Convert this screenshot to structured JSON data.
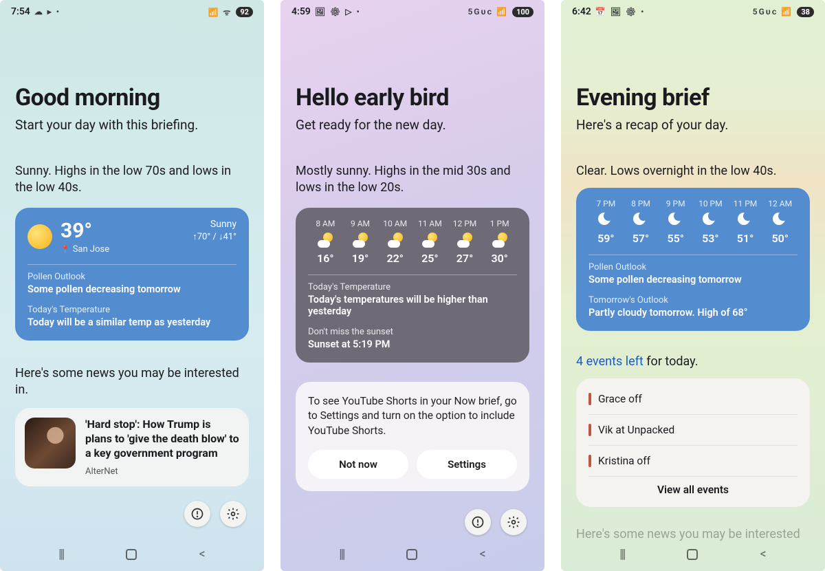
{
  "screens": [
    {
      "status": {
        "time": "7:54",
        "left_icons": "☁ ▸ •",
        "right_icons": "📶 ᯤ",
        "battery": "92"
      },
      "greeting": "Good morning",
      "subtitle": "Start your day with this briefing.",
      "summary": "Sunny. Highs in the low 70s and lows in the low 40s.",
      "weather": {
        "temp": "39°",
        "location": "San Jose",
        "condition": "Sunny",
        "hilo": "↑70° / ↓41°",
        "lines": [
          {
            "label": "Pollen Outlook",
            "value": "Some pollen decreasing tomorrow"
          },
          {
            "label": "Today's Temperature",
            "value": "Today will be a similar temp as yesterday"
          }
        ]
      },
      "news_intro": "Here's some news you may be interested in.",
      "news": {
        "title": "'Hard stop': How Trump is plans to 'give the death blow' to a key government program",
        "source": "AlterNet"
      }
    },
    {
      "status": {
        "time": "4:59",
        "left_icons": "🖼 ⚙ ▷ •",
        "right_icons": "5Gᴜᴄ 📶",
        "battery": "100"
      },
      "greeting": "Hello early bird",
      "subtitle": "Get ready for the new day.",
      "summary": "Mostly sunny. Highs in the mid 30s and lows in the low 20s.",
      "hourly": [
        {
          "t": "8 AM",
          "deg": "16°"
        },
        {
          "t": "9 AM",
          "deg": "19°"
        },
        {
          "t": "10 AM",
          "deg": "22°"
        },
        {
          "t": "11 AM",
          "deg": "25°"
        },
        {
          "t": "12 PM",
          "deg": "27°"
        },
        {
          "t": "1 PM",
          "deg": "30°"
        }
      ],
      "weather_lines": [
        {
          "label": "Today's Temperature",
          "value": "Today's temperatures will be higher than yesterday"
        },
        {
          "label": "Don't miss the sunset",
          "value": "Sunset at 5:19 PM"
        }
      ],
      "prompt": {
        "text": "To see YouTube Shorts in your Now brief, go to Settings and turn on the option to include YouTube Shorts.",
        "notnow": "Not now",
        "settings": "Settings"
      }
    },
    {
      "status": {
        "time": "6:42",
        "left_icons": "📅 🖼 ⚙ •",
        "right_icons": "5Gᴜᴄ 📶",
        "battery": "38"
      },
      "greeting": "Evening brief",
      "subtitle": "Here's a recap of your day.",
      "summary": "Clear. Lows overnight in the low 40s.",
      "hourly": [
        {
          "t": "7 PM",
          "deg": "59°"
        },
        {
          "t": "8 PM",
          "deg": "57°"
        },
        {
          "t": "9 PM",
          "deg": "55°"
        },
        {
          "t": "10 PM",
          "deg": "53°"
        },
        {
          "t": "11 PM",
          "deg": "51°"
        },
        {
          "t": "12 AM",
          "deg": "50°"
        }
      ],
      "weather_lines": [
        {
          "label": "Pollen Outlook",
          "value": "Some pollen decreasing tomorrow"
        },
        {
          "label": "Tomorrow's Outlook",
          "value": "Partly cloudy tomorrow. High of 68°"
        }
      ],
      "events_lead_link": "4 events left",
      "events_lead_rest": " for today.",
      "events": [
        {
          "title": "Grace off"
        },
        {
          "title": "Vik at Unpacked"
        },
        {
          "title": "Kristina off"
        }
      ],
      "view_all": "View all events",
      "faded_news": "Here's some news you may be interested"
    }
  ]
}
